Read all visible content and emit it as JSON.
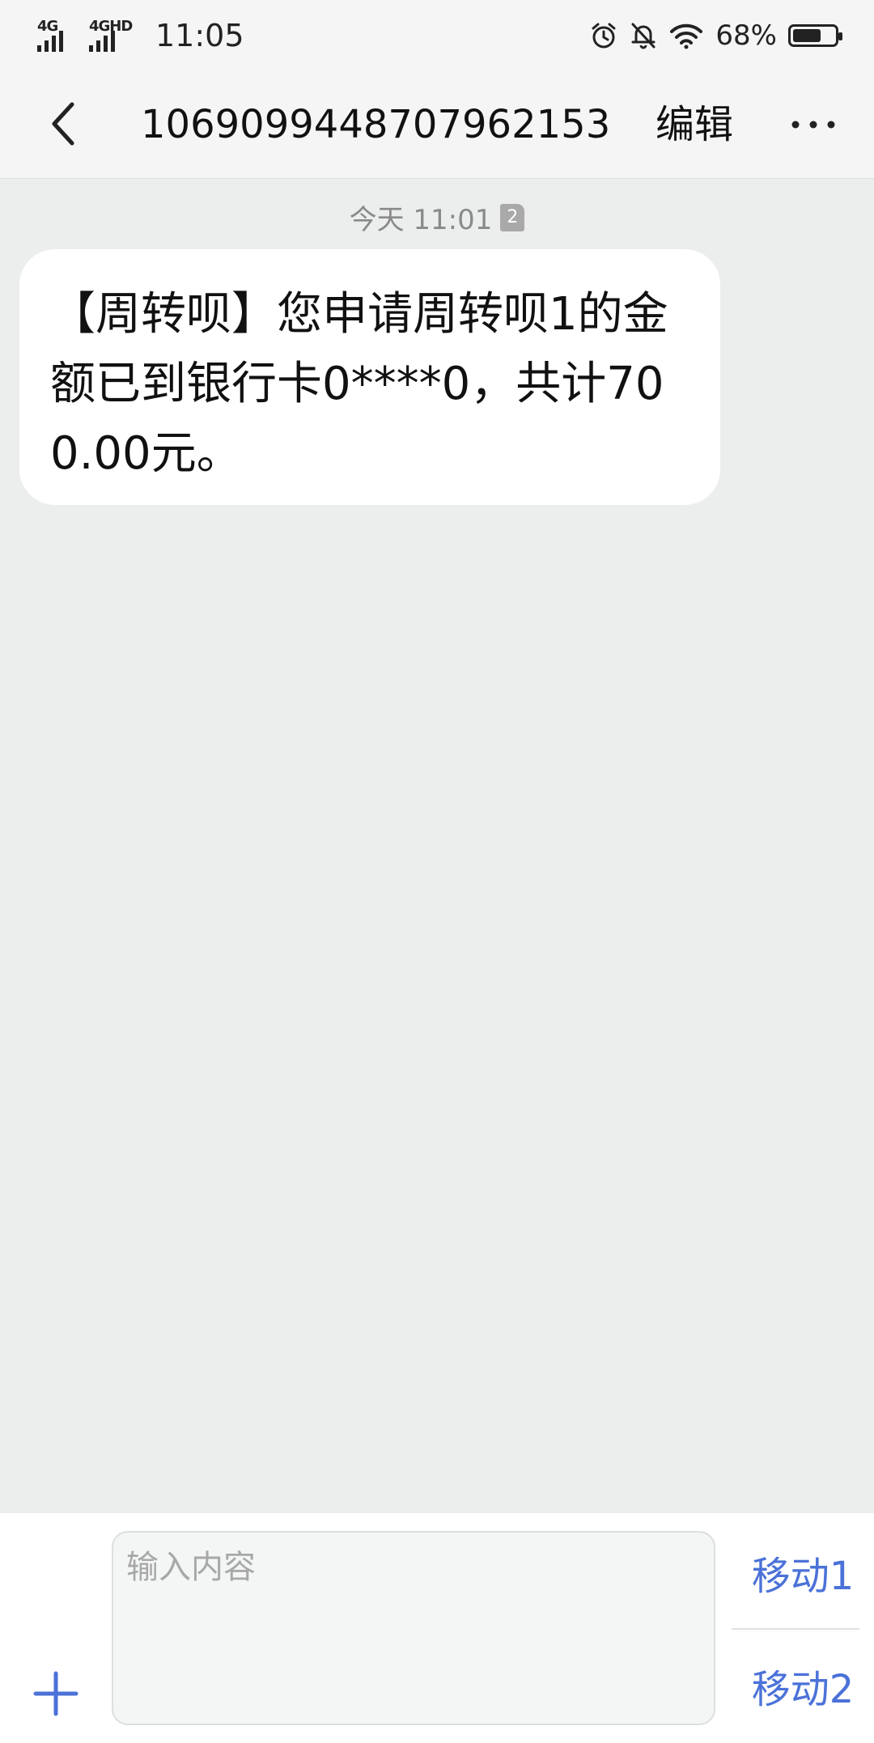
{
  "status_bar": {
    "signal1_label": "4G",
    "signal2_label": "4GHD",
    "time": "11:05",
    "battery_percent": "68%",
    "battery_level": 0.68,
    "icons": [
      "alarm-icon",
      "bell-off-icon",
      "wifi-icon",
      "battery-icon"
    ]
  },
  "header": {
    "title": "1069099448707962153",
    "edit_label": "编辑",
    "back_icon": "chevron-left-icon",
    "more_icon": "more-dots-icon"
  },
  "conversation": {
    "timestamp": "今天 11:01",
    "sim_badge": "2",
    "messages": [
      {
        "text": "【周转呗】您申请周转呗1的金额已到银行卡0****0，共计700.00元。"
      }
    ]
  },
  "composer": {
    "placeholder": "输入内容",
    "send_sim1_label": "移动1",
    "send_sim2_label": "移动2",
    "plus_icon": "plus-icon"
  },
  "colors": {
    "accent": "#4b72d8",
    "chat_background": "#eceeee",
    "bubble_background": "#ffffff",
    "header_background": "#f5f5f5"
  }
}
